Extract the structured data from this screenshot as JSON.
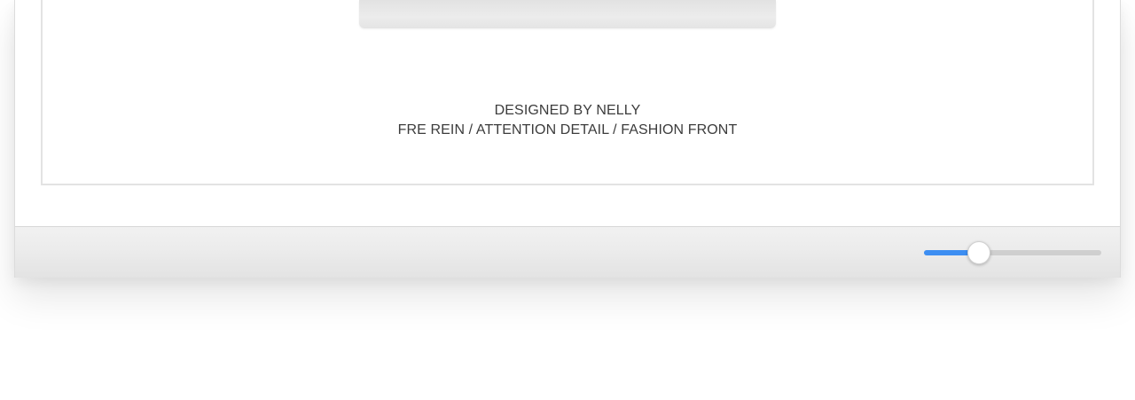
{
  "credits": {
    "designer": "DESIGNED BY NELLY",
    "tags": "FRE REIN / ATTENTION DETAIL / FASHION FRONT"
  },
  "zoom_slider": {
    "value": 0.31,
    "accent_color": "#3d8ef2"
  }
}
